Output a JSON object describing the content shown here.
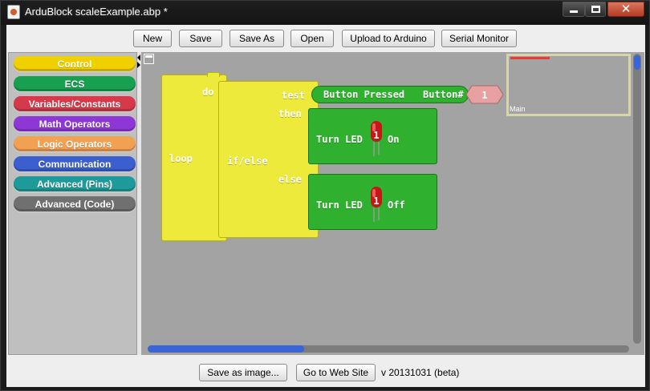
{
  "window": {
    "title": "ArduBlock scaleExample.abp *",
    "controls": {
      "minimize": "–",
      "maximize": "□",
      "close": "✕"
    }
  },
  "toolbar": {
    "new_label": "New",
    "save_label": "Save",
    "save_as_label": "Save As",
    "open_label": "Open",
    "upload_label": "Upload to Arduino",
    "serial_monitor_label": "Serial Monitor"
  },
  "palette": {
    "categories": [
      {
        "label": "Control",
        "color": "#f1d000"
      },
      {
        "label": "ECS",
        "color": "#18a050"
      },
      {
        "label": "Variables/Constants",
        "color": "#d63a4a"
      },
      {
        "label": "Math Operators",
        "color": "#8f37d6"
      },
      {
        "label": "Logic Operators",
        "color": "#f2a052"
      },
      {
        "label": "Communication",
        "color": "#3b5fcf"
      },
      {
        "label": "Advanced (Pins)",
        "color": "#1f9a9a"
      },
      {
        "label": "Advanced (Code)",
        "color": "#707070"
      }
    ]
  },
  "canvas": {
    "loop_block": {
      "label": "loop",
      "do_label": "do"
    },
    "ifelse_block": {
      "label": "if/else",
      "test_label": "test",
      "then_label": "then",
      "else_label": "else"
    },
    "button_pressed_block": {
      "label": "Button Pressed",
      "pin_label": "Button#",
      "pin_value": "1"
    },
    "led_on_block": {
      "prefix": "Turn LED",
      "number": "1",
      "suffix": "On"
    },
    "led_off_block": {
      "prefix": "Turn LED",
      "number": "1",
      "suffix": "Off"
    },
    "minimap": {
      "label": "Main"
    }
  },
  "bottom": {
    "save_image_label": "Save as image...",
    "website_label": "Go to Web Site",
    "version": "v 20131031 (beta)"
  },
  "colors": {
    "control_yellow": "#eeea3c",
    "block_green": "#2fb02f",
    "input_pink": "#e8a0a0",
    "workspace_gray": "#a3a3a3",
    "scroll_blue": "#3b64d4"
  }
}
